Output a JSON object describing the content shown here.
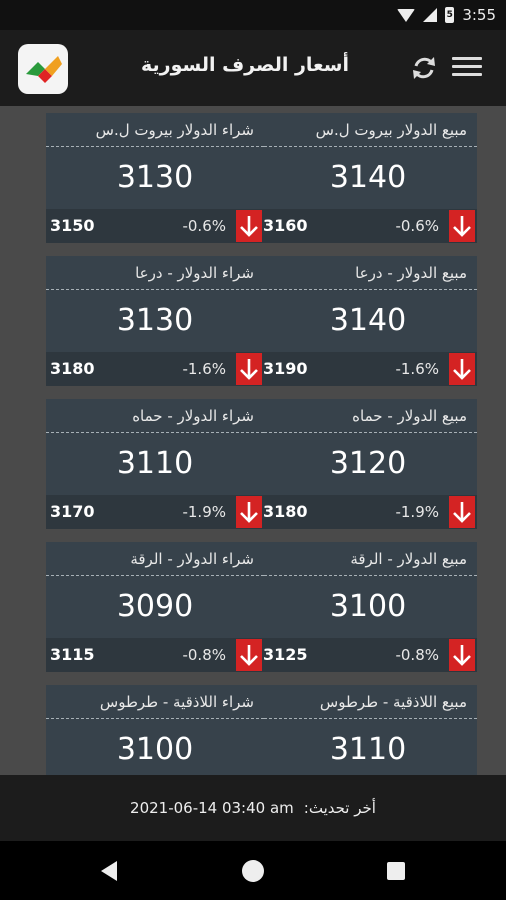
{
  "status": {
    "time": "3:55",
    "battery_label": "5"
  },
  "app": {
    "title": "أسعار الصرف السورية"
  },
  "cards": [
    {
      "title": "مبيع الدولار بيروت ل.س",
      "price": "3140",
      "percent": "-0.6%",
      "previous": "3160"
    },
    {
      "title": "شراء الدولار بيروت ل.س",
      "price": "3130",
      "percent": "-0.6%",
      "previous": "3150"
    },
    {
      "title": "مبيع الدولار - درعا",
      "price": "3140",
      "percent": "-1.6%",
      "previous": "3190"
    },
    {
      "title": "شراء الدولار - درعا",
      "price": "3130",
      "percent": "-1.6%",
      "previous": "3180"
    },
    {
      "title": "مبيع   الدولار - حماه",
      "price": "3120",
      "percent": "-1.9%",
      "previous": "3180"
    },
    {
      "title": "شراء    الدولار - حماه",
      "price": "3110",
      "percent": "-1.9%",
      "previous": "3170"
    },
    {
      "title": "مبيع الدولار - الرقة",
      "price": "3100",
      "percent": "-0.8%",
      "previous": "3125"
    },
    {
      "title": "شراء الدولار - الرقة",
      "price": "3090",
      "percent": "-0.8%",
      "previous": "3115"
    },
    {
      "title": "مبيع اللاذقية - طرطوس",
      "price": "3110"
    },
    {
      "title": "شراء اللاذقية - طرطوس",
      "price": "3100"
    }
  ],
  "footer": {
    "label": "أخر تحديث:",
    "timestamp": "2021-06-14 03:40 am"
  },
  "colors": {
    "down": "#d42323",
    "card_bg": "#37424b",
    "card_foot": "#2e373e"
  }
}
